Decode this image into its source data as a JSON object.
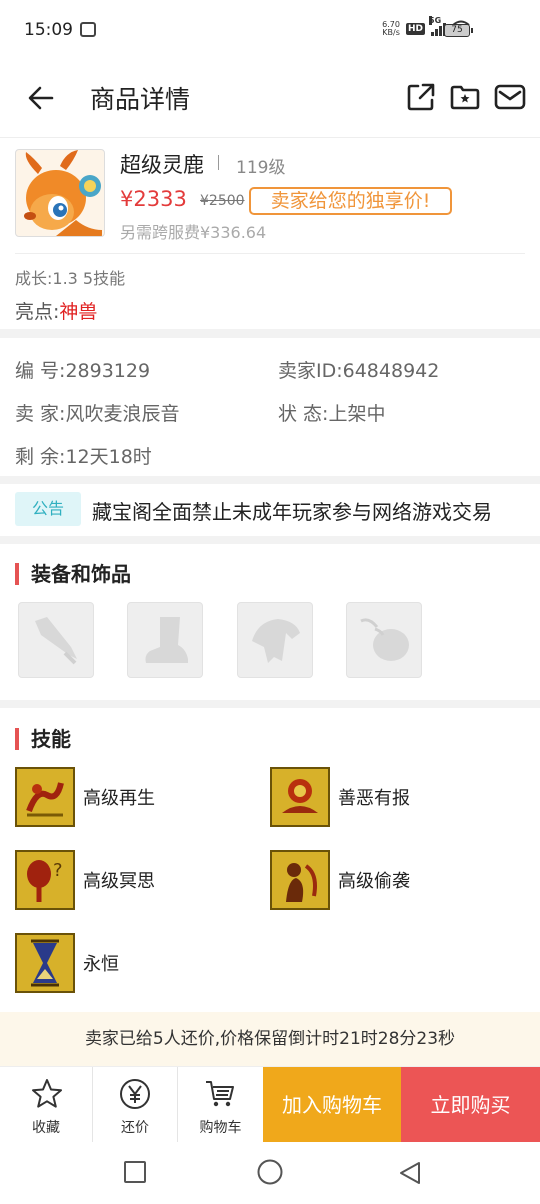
{
  "status_bar": {
    "time": "15:09",
    "net_speed_value": "6.70",
    "net_speed_unit": "KB/s",
    "hd": "HD",
    "network": "5G",
    "battery": "75"
  },
  "header": {
    "title": "商品详情",
    "icons": [
      "back-arrow-icon",
      "share-icon",
      "favorite-folder-icon",
      "message-icon"
    ]
  },
  "product": {
    "name": "超级灵鹿",
    "level": "119级",
    "price": "¥2333",
    "original_price": "¥2500",
    "exclusive_label": "卖家给您的独享价!",
    "extra_fee": "另需跨服费¥336.64",
    "growth": "成长:1.3 5技能",
    "highlight_label": "亮点:",
    "highlight_value": "神兽"
  },
  "info": {
    "serial": "编 号:2893129",
    "seller_id": "卖家ID:64848942",
    "seller": "卖 家:风吹麦浪辰音",
    "status": "状 态:上架中",
    "remaining": "剩 余:12天18时"
  },
  "notice": {
    "tag": "公告",
    "text": "藏宝阁全面禁止未成年玩家参与网络游戏交易"
  },
  "equipment": {
    "title": "装备和饰品",
    "slots": [
      "weapon-slot-icon",
      "boots-slot-icon",
      "armor-slot-icon",
      "accessory-slot-icon"
    ]
  },
  "skills": {
    "title": "技能",
    "items": [
      {
        "label": "高级再生"
      },
      {
        "label": "善恶有报"
      },
      {
        "label": "高级冥思"
      },
      {
        "label": "高级偷袭"
      },
      {
        "label": "永恒"
      }
    ]
  },
  "bargain_banner": "卖家已给5人还价,价格保留倒计时21时28分23秒",
  "bottom_bar": {
    "favorite": "收藏",
    "bargain": "还价",
    "cart": "购物车",
    "add_to_cart": "加入购物车",
    "buy_now": "立即购买"
  },
  "colors": {
    "price_red": "#e33b3b",
    "highlight_red": "#e02020",
    "badge_orange": "#f0953a",
    "cart_button": "#f0a81b",
    "buy_button": "#ec5555",
    "notice_teal": "#30b0c0"
  }
}
